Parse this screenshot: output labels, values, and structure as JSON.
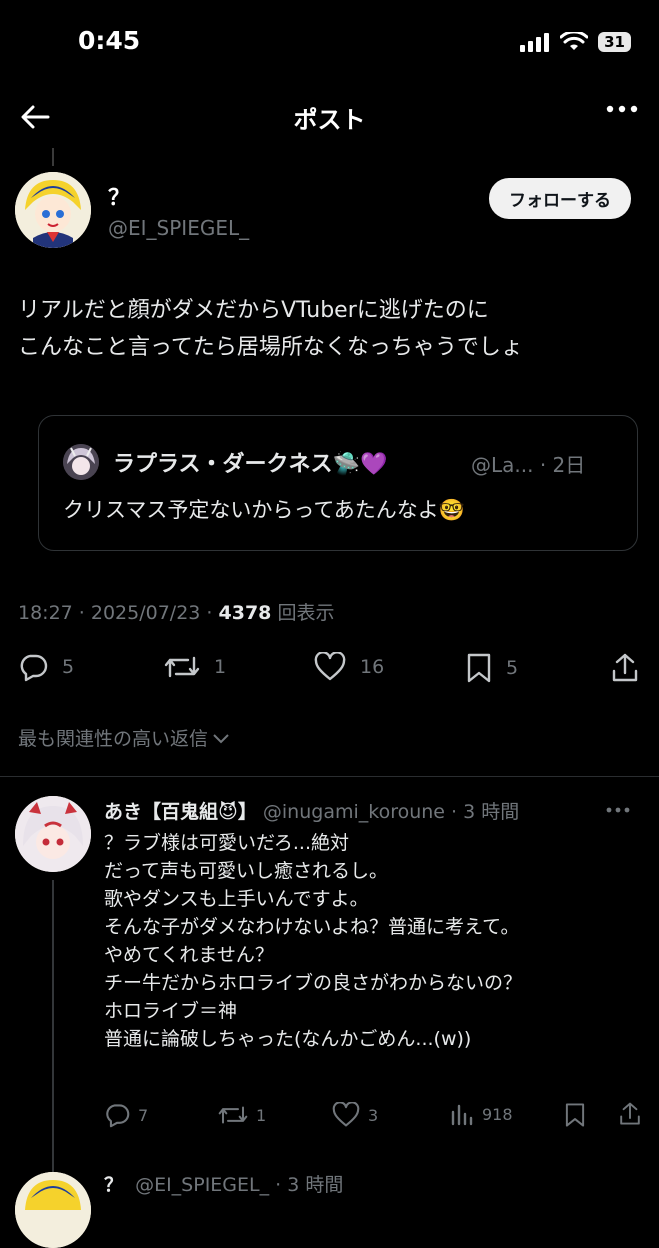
{
  "status_bar": {
    "time": "0:45",
    "battery": "31"
  },
  "header": {
    "title": "ポスト"
  },
  "post": {
    "display_name": "？",
    "handle": "@EI_SPIEGEL_",
    "follow_label": "フォローする",
    "text_lines": [
      "リアルだと顔がダメだからVTuberに逃げたのに",
      "こんなこと言ってたら居場所なくなっちゃうでしょ"
    ],
    "quote": {
      "name": "ラプラス・ダークネス",
      "emoji": "🛸💜",
      "handle_date": "@La... · 2日",
      "text": "クリスマス予定ないからってあたんなよ🤓"
    },
    "meta_time": "18:27 · 2025/07/23 · ",
    "views_count": "4378",
    "views_label": " 回表示",
    "stats": {
      "replies": "5",
      "reposts": "1",
      "likes": "16",
      "bookmarks": "5"
    }
  },
  "sort": {
    "label": "最も関連性の高い返信"
  },
  "reply": {
    "name": "あき【百鬼組",
    "emoji": "😈",
    "name_close": "】",
    "handle_time": "@inugami_koroune · 3 時間",
    "lines": [
      "？ラブ様は可愛いだろ...絶対",
      "だって声も可愛いし癒されるし。",
      "歌やダンスも上手いんですよ。",
      "そんな子がダメなわけないよね？普通に考えて。",
      "やめてくれません？",
      "チー牛だからホロライブの良さがわからないの？",
      "ホロライブ＝神",
      "普通に論破しちゃった(なんかごめん...(w))"
    ],
    "stats": {
      "replies": "7",
      "reposts": "1",
      "likes": "3",
      "views": "918"
    }
  },
  "next_reply": {
    "name": "？",
    "handle_time": "@EI_SPIEGEL_ · 3 時間"
  }
}
